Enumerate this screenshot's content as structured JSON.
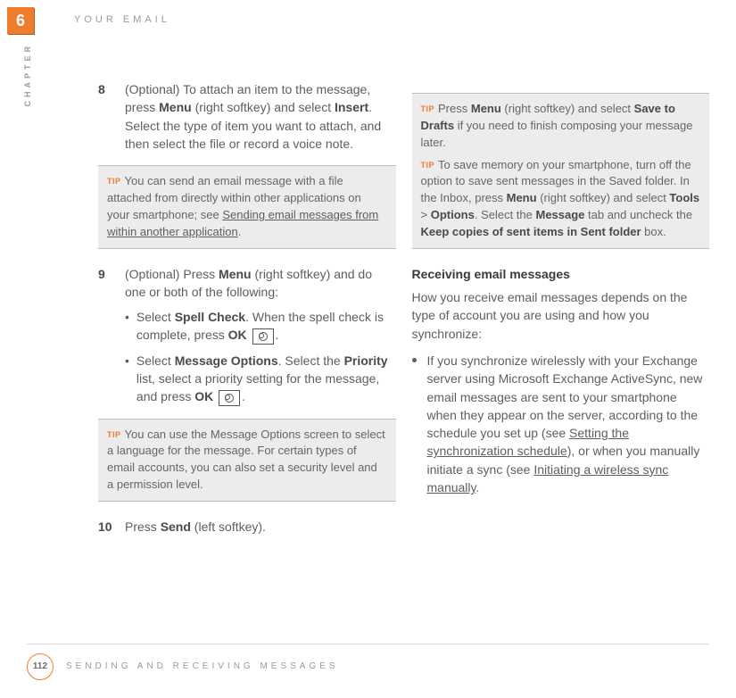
{
  "chapter_number": "6",
  "header_label": "YOUR EMAIL",
  "side_label": "CHAPTER",
  "page_number": "112",
  "footer_text": "SENDING AND RECEIVING MESSAGES",
  "tip_label": "TIP",
  "left": {
    "step8": {
      "num": "8",
      "text_a": "(Optional) To attach an item to the message, press ",
      "menu": "Menu",
      "text_b": " (right softkey) and select ",
      "insert": "Insert",
      "text_c": ". Select the type of item you want to attach, and then select the file or record a voice note."
    },
    "tip1": {
      "a": "You can send an email message with a file attached from directly within other applications on your smartphone; see ",
      "link": "Sending email messages from within another application",
      "dot": "."
    },
    "step9": {
      "num": "9",
      "text_a": "(Optional) Press ",
      "menu": "Menu",
      "text_b": " (right softkey) and do one or both of the following:",
      "sub1_a": "Select ",
      "sub1_bold": "Spell Check",
      "sub1_b": ". When the spell check is complete, press ",
      "ok": "OK",
      "sub1_c": ".",
      "sub2_a": "Select ",
      "sub2_bold1": "Message Options",
      "sub2_b": ". Select the ",
      "sub2_bold2": "Priority",
      "sub2_c": " list, select a priority setting for the message, and press ",
      "sub2_d": "."
    },
    "tip2": "You can use the Message Options screen to select a language for the message. For certain types of email accounts, you can also set a security level and a permission level.",
    "step10": {
      "num": "10",
      "a": "Press ",
      "send": "Send",
      "b": " (left softkey)."
    }
  },
  "right": {
    "tip1_a": "Press ",
    "tip1_menu": "Menu",
    "tip1_b": " (right softkey) and select ",
    "tip1_save": "Save to Drafts",
    "tip1_c": " if you need to finish composing your message later.",
    "tip2_a": "To save memory on your smartphone, turn off the option to save sent messages in the Saved folder. In the Inbox, press ",
    "tip2_menu": "Menu",
    "tip2_b": " (right softkey) and select ",
    "tip2_tools": "Tools",
    "tip2_gt": " > ",
    "tip2_options": "Options",
    "tip2_c": ". Select the ",
    "tip2_message": "Message",
    "tip2_d": " tab and uncheck the ",
    "tip2_keep": "Keep copies of sent items in Sent folder",
    "tip2_e": " box.",
    "heading": "Receiving email messages",
    "intro": "How you receive email messages depends on the type of account you are using and how you synchronize:",
    "bullet_a": "If you synchronize wirelessly with your Exchange server using Microsoft Exchange ActiveSync, new email messages are sent to your smartphone when they appear on the server, according to the schedule you set up (see ",
    "bullet_link1": "Setting the synchronization schedule",
    "bullet_b": "), or when you manually initiate a sync (see ",
    "bullet_link2": "Initiating a wireless sync manually",
    "bullet_c": "."
  }
}
